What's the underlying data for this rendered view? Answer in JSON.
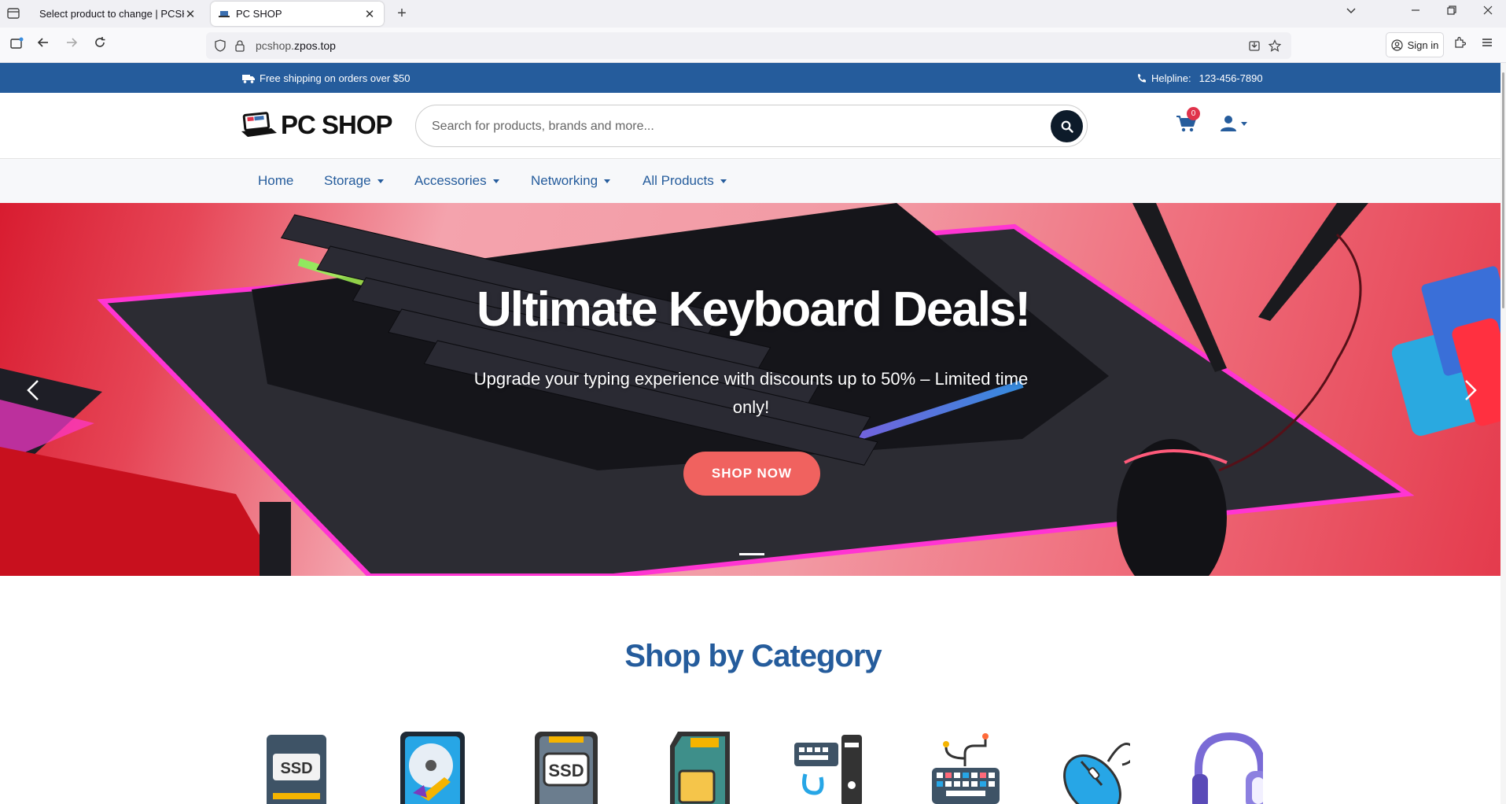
{
  "browser": {
    "tabs": [
      {
        "title": "Select product to change | PCSHOP",
        "active": false
      },
      {
        "title": "PC SHOP",
        "active": true
      }
    ],
    "url_prefix": "pcshop.",
    "url_domain": "zpos.top",
    "sign_in_label": "Sign in",
    "new_tab_glyph": "+",
    "close_glyph": "✕"
  },
  "topbar": {
    "shipping_text": "Free shipping on orders over $50",
    "helpline_label": "Helpline:",
    "helpline_number": "123-456-7890",
    "bg_color": "#255c9c"
  },
  "header": {
    "logo_text": "PC SHOP",
    "search_placeholder": "Search for products, brands and more...",
    "cart_count": "0"
  },
  "menu": {
    "items": [
      {
        "label": "Home",
        "dropdown": false
      },
      {
        "label": "Storage",
        "dropdown": true
      },
      {
        "label": "Accessories",
        "dropdown": true
      },
      {
        "label": "Networking",
        "dropdown": true
      },
      {
        "label": "All Products",
        "dropdown": true
      }
    ]
  },
  "hero": {
    "title": "Ultimate Keyboard Deals!",
    "subtitle": "Upgrade your typing experience with discounts up to 50% – Limited time only!",
    "cta_label": "SHOP NOW",
    "cta_color": "#f0625f"
  },
  "categories": {
    "title": "Shop by Category",
    "icons": [
      "ssd-drive-icon",
      "hard-disk-icon",
      "ssd-icon",
      "memory-card-icon",
      "computer-accessories-icon",
      "keyboard-icon",
      "mouse-icon",
      "headphones-icon"
    ]
  }
}
